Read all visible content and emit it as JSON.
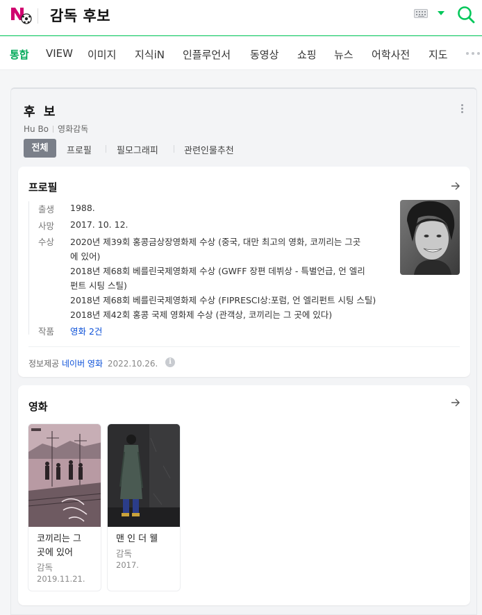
{
  "header": {
    "logo_icon": "naver-sports-logo-icon",
    "query": "감독 후보",
    "keyboard_icon": "keyboard-icon",
    "dropdown_icon": "caret-down-icon",
    "search_icon": "search-icon",
    "accent_color": "#03c75a"
  },
  "tabs": [
    {
      "label": "통합",
      "active": true
    },
    {
      "label": "VIEW"
    },
    {
      "label": "이미지"
    },
    {
      "label": "지식iN"
    },
    {
      "label": "인플루언서"
    },
    {
      "label": "동영상"
    },
    {
      "label": "쇼핑"
    },
    {
      "label": "뉴스"
    },
    {
      "label": "어학사전"
    },
    {
      "label": "지도"
    }
  ],
  "person": {
    "name": "후 보",
    "romanized": "Hu Bo",
    "occupation": "영화감독",
    "subtabs": [
      "전체",
      "프로필",
      "필모그래피",
      "관련인물추천"
    ]
  },
  "profile": {
    "title": "프로필",
    "birth_label": "출생",
    "birth": "1988.",
    "death_label": "사망",
    "death": "2017. 10. 12.",
    "awards_label": "수상",
    "awards": [
      "2020년 제39회 홍콩금상장영화제 수상 (중국, 대만 최고의 영화, 코끼리는 그곳",
      "에 있어)",
      "2018년 제68회 베를린국제영화제 수상 (GWFF 장편 데뷔상 - 특별언급, 언 엘리",
      "펀트 시팅 스틸)",
      "2018년 제68회 베를린국제영화제 수상 (FIPRESCI상:포럼, 언 엘리펀트 시팅 스틸)",
      "2018년 제42회 홍콩 국제 영화제 수상 (관객상, 코끼리는 그 곳에 있다)"
    ],
    "works_label": "작품",
    "works": "영화 2건",
    "source_label": "정보제공",
    "source_link": "네이버 영화",
    "source_date": "2022.10.26."
  },
  "movies": {
    "title": "영화",
    "items": [
      {
        "title_line1": "코끼리는 그",
        "title_line2": "곳에 있어",
        "role": "감독",
        "date": "2019.11.21."
      },
      {
        "title_line1": "맨 인 더 웰",
        "role": "감독",
        "date": "2017."
      }
    ]
  }
}
